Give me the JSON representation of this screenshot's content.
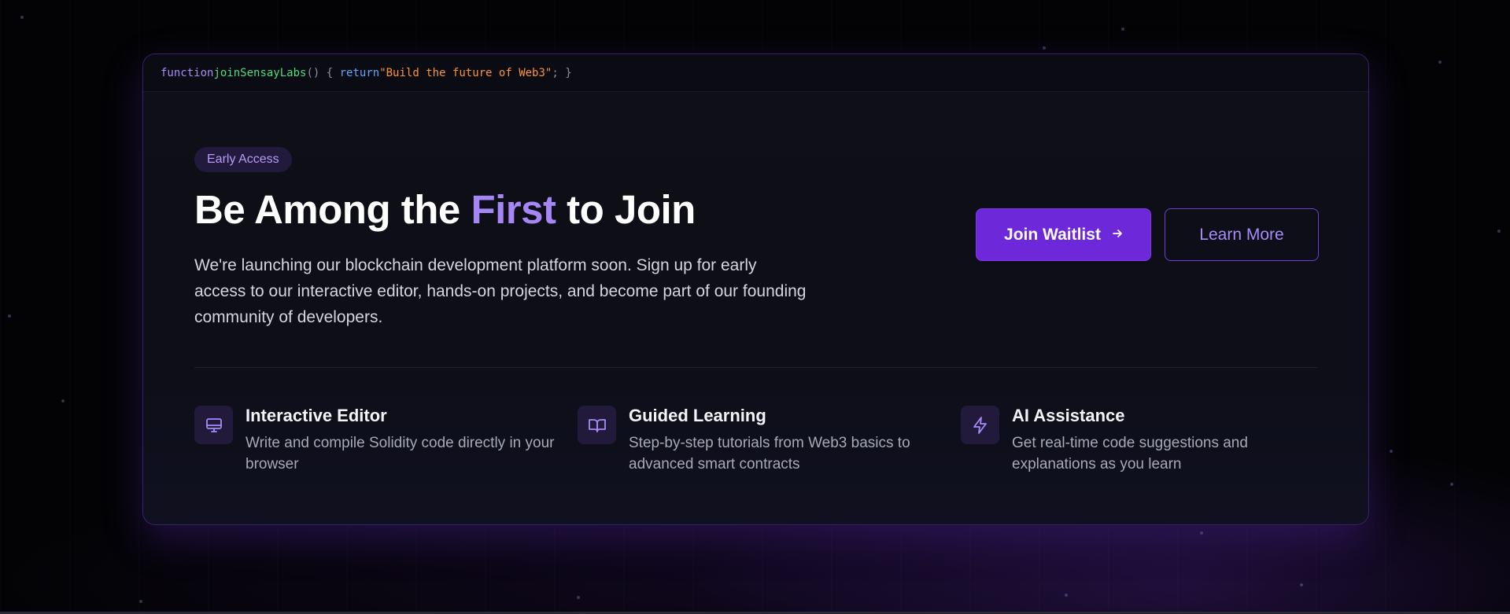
{
  "code_snippet": {
    "keyword": "function",
    "function_name": "joinSensayLabs",
    "open": "() { ",
    "return_keyword": "return",
    "string": "\"Build the future of Web3\"",
    "close": "; }"
  },
  "hero": {
    "badge": "Early Access",
    "title_before": "Be Among the ",
    "title_accent": "First",
    "title_after": " to Join",
    "description": "We're launching our blockchain development platform soon. Sign up for early access to our interactive editor, hands-on projects, and become part of our founding community of developers."
  },
  "actions": {
    "primary_label": "Join Waitlist",
    "primary_icon": "arrow-right-icon",
    "secondary_label": "Learn More"
  },
  "features": [
    {
      "icon": "monitor-icon",
      "title": "Interactive Editor",
      "description": "Write and compile Solidity code directly in your browser"
    },
    {
      "icon": "book-open-icon",
      "title": "Guided Learning",
      "description": "Step-by-step tutorials from Web3 basics to advanced smart contracts"
    },
    {
      "icon": "zap-icon",
      "title": "AI Assistance",
      "description": "Get real-time code suggestions and explanations as you learn"
    }
  ],
  "colors": {
    "accent": "#a685f5",
    "primary_button": "#6d28d9",
    "background": "#030305",
    "card": "#0e0f17"
  }
}
